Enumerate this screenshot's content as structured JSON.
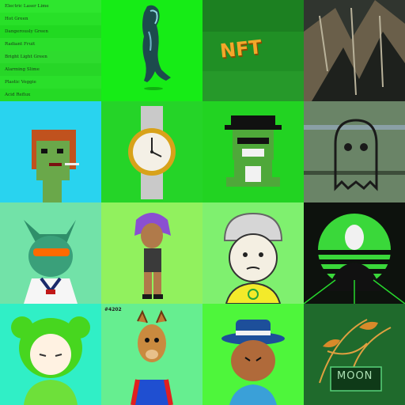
{
  "swatches": [
    {
      "name": "Electric Laser Lime",
      "color": "#2ee62e"
    },
    {
      "name": "Hot Green",
      "color": "#28e028"
    },
    {
      "name": "Dangerously Green",
      "color": "#21d921"
    },
    {
      "name": "Radiant Fruit",
      "color": "#2bdf2b"
    },
    {
      "name": "Bright Light Green",
      "color": "#2edb2e"
    },
    {
      "name": "Alarming Slime",
      "color": "#27d627"
    },
    {
      "name": "Plastic Veggie",
      "color": "#2adf2a"
    },
    {
      "name": "Acid Reflux",
      "color": "#25da25"
    }
  ],
  "tiles": {
    "nft_label": "NFT",
    "badge_label": "#4202",
    "moon_label": "MOON"
  },
  "icons": [
    "panther-statue-icon",
    "nft-text-tile",
    "glitch-art-icon",
    "pixel-punk-icon",
    "wristwatch-icon",
    "pixel-frog-icon",
    "glitch-ghost-icon",
    "cat-sunglasses-icon",
    "punk-girl-icon",
    "bucket-hat-dog-icon",
    "anonymous-mask-icon",
    "green-girl-icon",
    "llama-icon",
    "fedora-man-icon",
    "moon-plant-icon"
  ]
}
